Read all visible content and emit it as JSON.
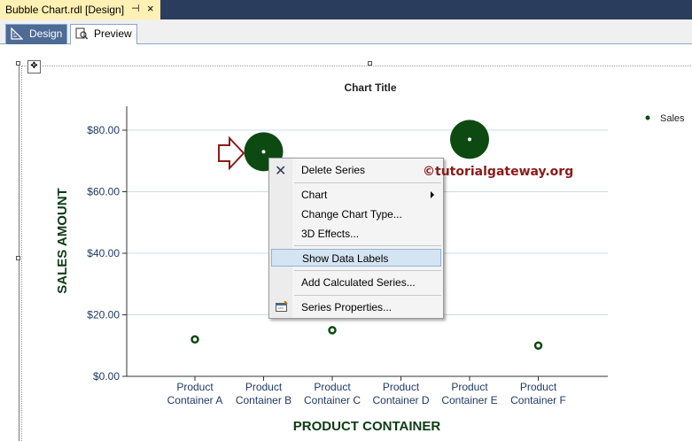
{
  "window": {
    "doc_tab_title": "Bubble Chart.rdl [Design]",
    "pin_glyph": "⊣",
    "close_glyph": "×"
  },
  "tabs": [
    {
      "label": "Design",
      "icon": "ruler-icon"
    },
    {
      "label": "Preview",
      "icon": "preview-icon"
    }
  ],
  "colors": {
    "bubble": "#0d4a12",
    "axis_text": "#1f3a63",
    "axis_title": "#0d3b14",
    "gridline": "#c8dce8",
    "arrow": "#8b1a1a"
  },
  "chart_data": {
    "type": "scatter",
    "title": "Chart Title",
    "xlabel": "PRODUCT CONTAINER",
    "ylabel": "SALES AMOUNT",
    "categories": [
      "Product Container A",
      "Product Container B",
      "Product Container C",
      "Product Container D",
      "Product Container E",
      "Product Container F"
    ],
    "category_lines": [
      [
        "Product",
        "Container A"
      ],
      [
        "Product",
        "Container B"
      ],
      [
        "Product",
        "Container C"
      ],
      [
        "Product",
        "Container D"
      ],
      [
        "Product",
        "Container E"
      ],
      [
        "Product",
        "Container F"
      ]
    ],
    "yticks": [
      "$0.00",
      "$20.00",
      "$40.00",
      "$60.00",
      "$80.00"
    ],
    "ylim": [
      0,
      80
    ],
    "grid": true,
    "legend_position": "top-right",
    "series": [
      {
        "name": "Sales",
        "points": [
          {
            "category": "Product Container A",
            "y": 12,
            "size": "small"
          },
          {
            "category": "Product Container B",
            "y": 73,
            "size": "large"
          },
          {
            "category": "Product Container C",
            "y": 15,
            "size": "small"
          },
          {
            "category": "Product Container E",
            "y": 77,
            "size": "large"
          },
          {
            "category": "Product Container F",
            "y": 10,
            "size": "small"
          }
        ]
      }
    ]
  },
  "context_menu": {
    "items": [
      {
        "label": "Delete Series",
        "icon": "delete-x-icon"
      },
      {
        "label": "Chart",
        "submenu": true
      },
      {
        "label": "Change Chart Type..."
      },
      {
        "label": "3D Effects..."
      },
      {
        "label": "Show Data Labels",
        "highlighted": true
      },
      {
        "label": "Add Calculated Series..."
      },
      {
        "label": "Series Properties...",
        "icon": "properties-icon"
      }
    ]
  },
  "watermark": "©tutorialgateway.org"
}
